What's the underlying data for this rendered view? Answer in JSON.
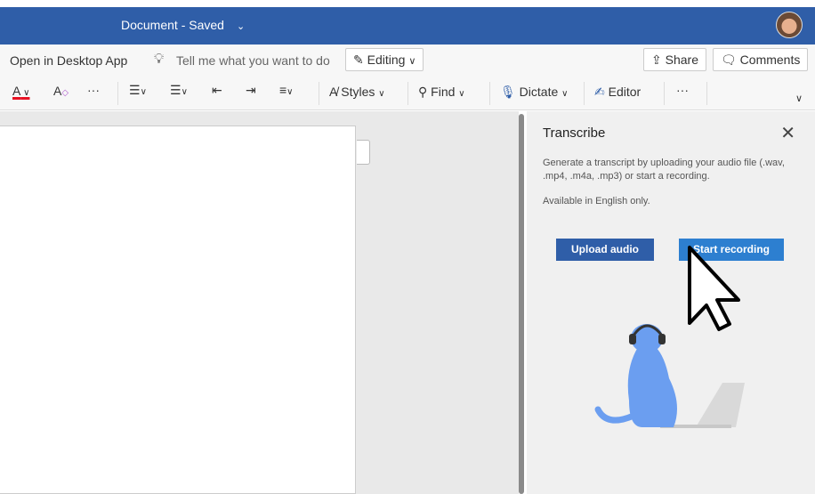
{
  "titlebar": {
    "title": "Document - Saved",
    "chevron": "⌄"
  },
  "ribbon": {
    "open_desktop": "Open in Desktop App",
    "tell_me": "Tell me what you want to do",
    "editing": "Editing",
    "share": "Share",
    "comments": "Comments",
    "styles": "Styles",
    "find": "Find",
    "dictate": "Dictate",
    "editor": "Editor",
    "more": "···"
  },
  "panel": {
    "title": "Transcribe",
    "description": "Generate a transcript by uploading your audio file (.wav, .mp4, .m4a, .mp3) or start a recording.",
    "availability": "Available in English only.",
    "upload_label": "Upload audio",
    "record_label": "Start recording"
  },
  "colors": {
    "brand": "#2f5ea8",
    "accent": "#2d7fd0",
    "font_color": "#e81123"
  }
}
